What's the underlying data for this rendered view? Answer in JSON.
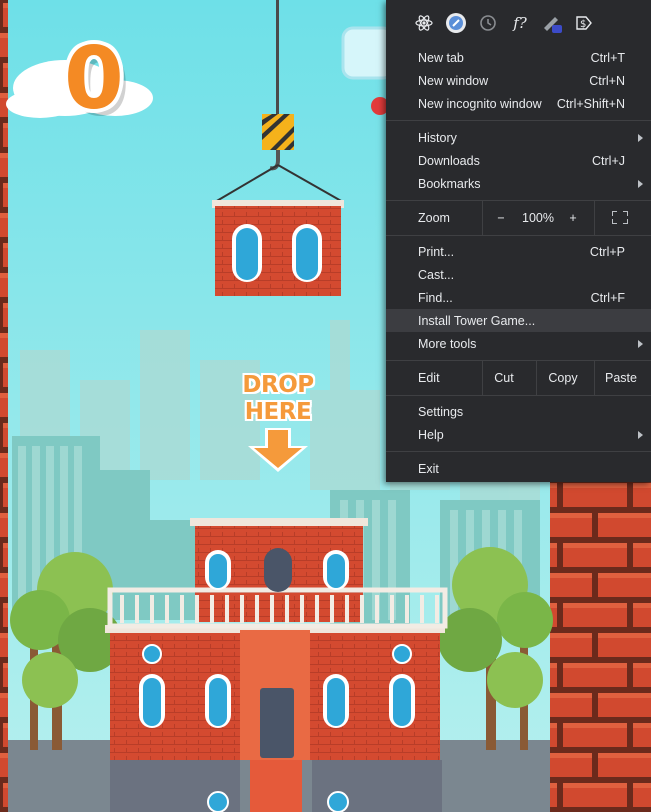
{
  "game": {
    "score": "0",
    "drop_hint": "DROP HERE"
  },
  "menu": {
    "extensions": [
      "react-devtools-icon",
      "circle-extension-icon",
      "timer-extension-icon",
      "function-extension-icon",
      "pen-tool-icon",
      "dollar-extension-icon"
    ],
    "group1": [
      {
        "label": "New tab",
        "shortcut": "Ctrl+T"
      },
      {
        "label": "New window",
        "shortcut": "Ctrl+N"
      },
      {
        "label": "New incognito window",
        "shortcut": "Ctrl+Shift+N"
      }
    ],
    "group2": [
      {
        "label": "History",
        "shortcut": ""
      },
      {
        "label": "Downloads",
        "shortcut": "Ctrl+J"
      },
      {
        "label": "Bookmarks",
        "shortcut": ""
      }
    ],
    "zoom": {
      "label": "Zoom",
      "minus": "−",
      "value": "100%",
      "plus": "+"
    },
    "group3": [
      {
        "label": "Print...",
        "shortcut": "Ctrl+P"
      },
      {
        "label": "Cast...",
        "shortcut": ""
      },
      {
        "label": "Find...",
        "shortcut": "Ctrl+F"
      },
      {
        "label": "Install Tower Game...",
        "shortcut": ""
      },
      {
        "label": "More tools",
        "shortcut": ""
      }
    ],
    "edit": {
      "label": "Edit",
      "cut": "Cut",
      "copy": "Copy",
      "paste": "Paste"
    },
    "group4": [
      {
        "label": "Settings",
        "shortcut": ""
      },
      {
        "label": "Help",
        "shortcut": ""
      }
    ],
    "exit": "Exit"
  }
}
